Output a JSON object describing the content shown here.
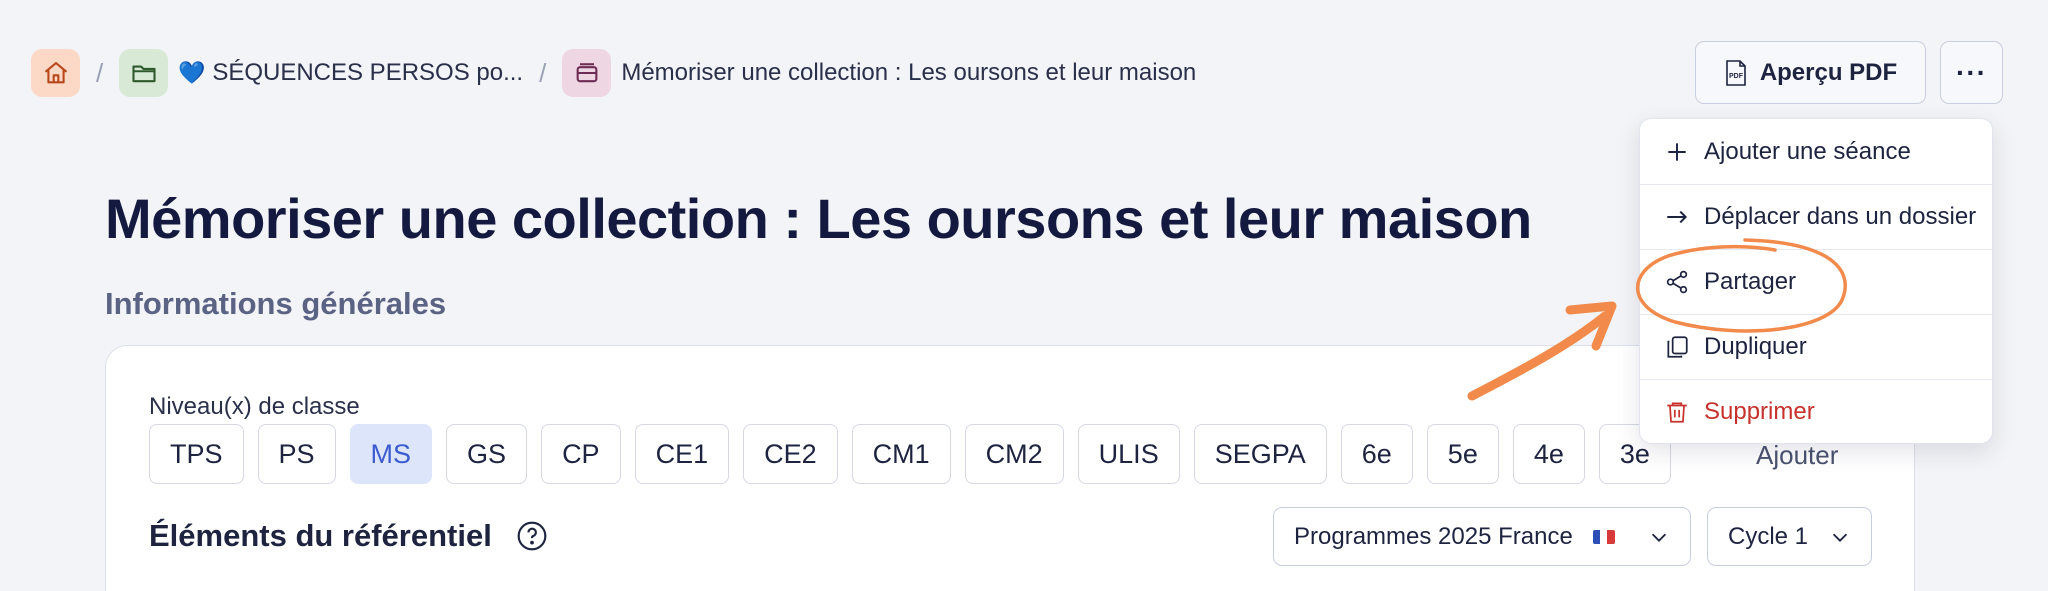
{
  "breadcrumb": {
    "folder_heart": "💙",
    "folder_label": "SÉQUENCES PERSOS po...",
    "current_label": "Mémoriser une collection : Les oursons et leur maison",
    "separator": "/"
  },
  "header": {
    "pdf_button_label": "Aperçu PDF",
    "pdf_badge": "PDF",
    "more_label": "···"
  },
  "page": {
    "title": "Mémoriser une collection : Les oursons et leur maison",
    "section_title": "Informations générales"
  },
  "niveaux": {
    "label": "Niveau(x) de classe",
    "levels": [
      "TPS",
      "PS",
      "MS",
      "GS",
      "CP",
      "CE1",
      "CE2",
      "CM1",
      "CM2",
      "ULIS",
      "SEGPA",
      "6e",
      "5e",
      "4e",
      "3e"
    ],
    "selected": "MS",
    "add_label": "Ajouter"
  },
  "referentiel": {
    "title": "Éléments du référentiel",
    "program_select": "Programmes 2025 France",
    "cycle_select": "Cycle 1"
  },
  "menu": {
    "items": [
      {
        "label": "Ajouter une séance",
        "icon": "plus-icon"
      },
      {
        "label": "Déplacer dans un dossier",
        "icon": "arrow-right-icon"
      },
      {
        "label": "Partager",
        "icon": "share-icon"
      },
      {
        "label": "Dupliquer",
        "icon": "copy-icon"
      },
      {
        "label": "Supprimer",
        "icon": "trash-icon"
      }
    ]
  },
  "colors": {
    "accent": "#3b5bcf",
    "danger": "#c8322c",
    "annotation": "#f28a4b",
    "title": "#141a3f"
  }
}
